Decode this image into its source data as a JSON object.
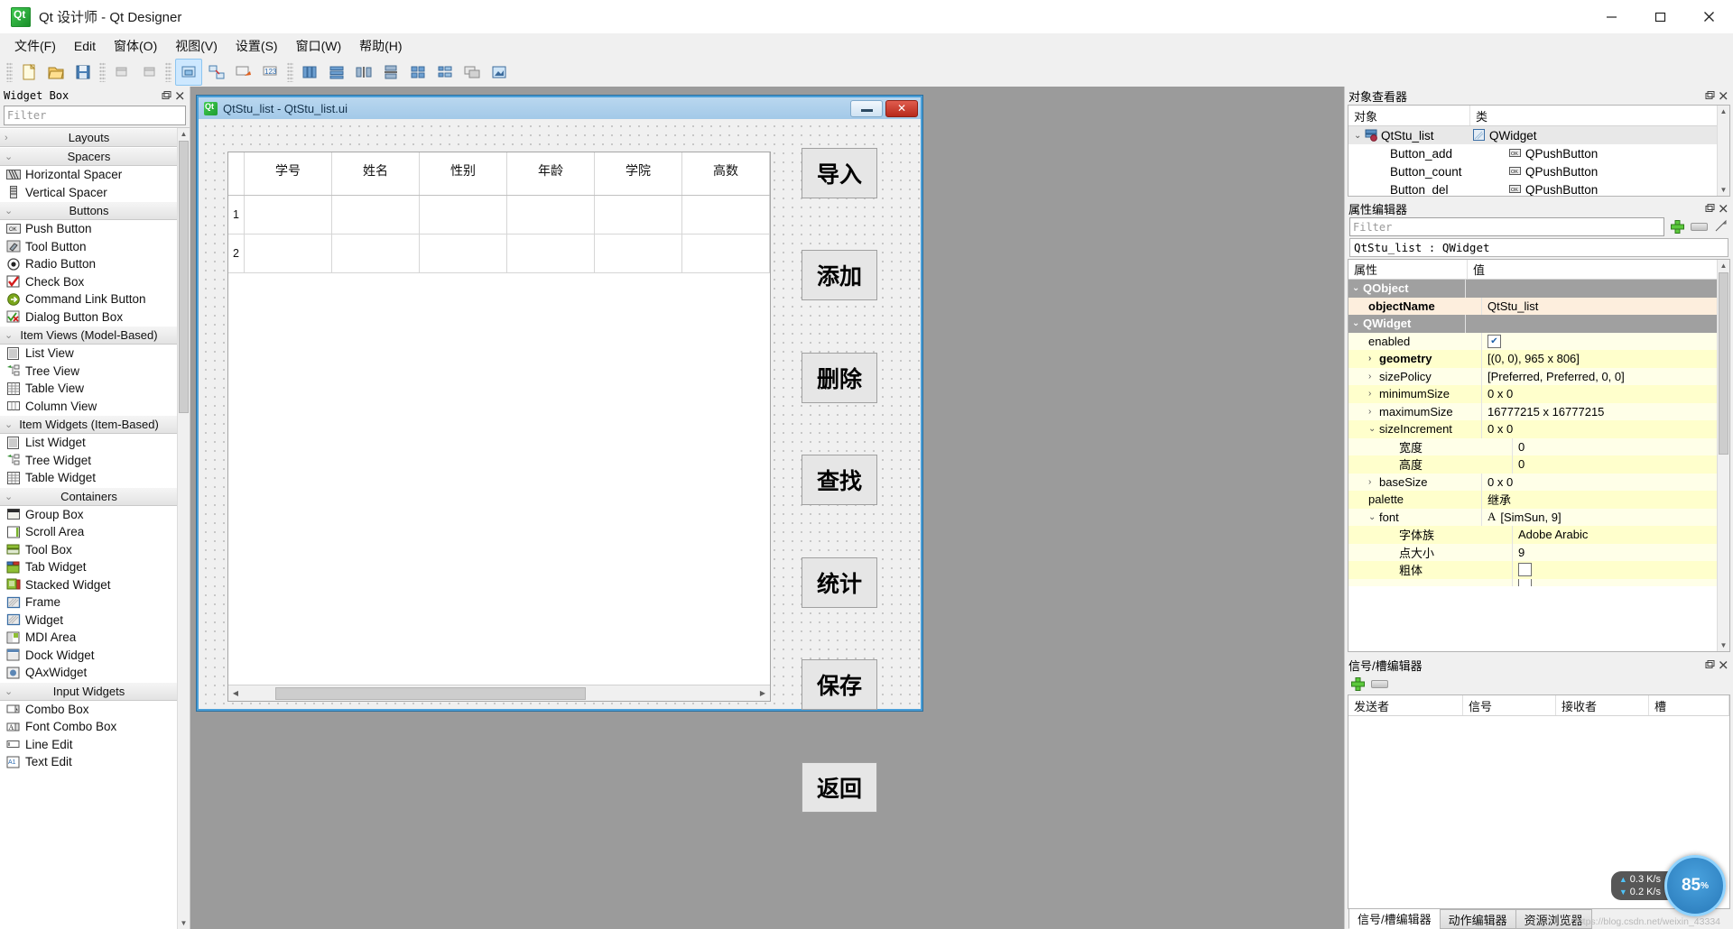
{
  "window": {
    "title": "Qt 设计师 - Qt Designer",
    "app_icon": "qt-logo-icon",
    "minimize": "−",
    "maximize": "□",
    "close": "✕"
  },
  "menubar": {
    "items": [
      {
        "label": "文件(F)",
        "name": "menu-file"
      },
      {
        "label": "Edit",
        "name": "menu-edit"
      },
      {
        "label": "窗体(O)",
        "name": "menu-form"
      },
      {
        "label": "视图(V)",
        "name": "menu-view"
      },
      {
        "label": "设置(S)",
        "name": "menu-settings"
      },
      {
        "label": "窗口(W)",
        "name": "menu-window"
      },
      {
        "label": "帮助(H)",
        "name": "menu-help"
      }
    ]
  },
  "toolbar": {
    "buttons": [
      {
        "name": "new-form-icon",
        "glyph": "new"
      },
      {
        "name": "open-form-icon",
        "glyph": "open"
      },
      {
        "name": "save-form-icon",
        "glyph": "save"
      },
      {
        "name": "undo-icon",
        "glyph": "undo"
      },
      {
        "name": "redo-icon",
        "glyph": "redo"
      },
      {
        "name": "edit-widgets-icon",
        "glyph": "editwidget",
        "active": true
      },
      {
        "name": "edit-signals-slots-icon",
        "glyph": "signals"
      },
      {
        "name": "edit-buddies-icon",
        "glyph": "buddies"
      },
      {
        "name": "edit-tab-order-icon",
        "glyph": "taborder"
      },
      {
        "name": "layout-horizontally-icon",
        "glyph": "lay-h"
      },
      {
        "name": "layout-vertically-icon",
        "glyph": "lay-v"
      },
      {
        "name": "layout-splitter-h-icon",
        "glyph": "split-h"
      },
      {
        "name": "layout-splitter-v-icon",
        "glyph": "split-v"
      },
      {
        "name": "layout-grid-icon",
        "glyph": "grid"
      },
      {
        "name": "layout-form-icon",
        "glyph": "formlay"
      },
      {
        "name": "break-layout-icon",
        "glyph": "breaklay"
      },
      {
        "name": "adjust-size-icon",
        "glyph": "adjust"
      }
    ]
  },
  "widget_box": {
    "title": "Widget Box",
    "filter_placeholder": "Filter",
    "groups": [
      {
        "label": "Layouts",
        "expanded": false,
        "chevron": "›",
        "items": []
      },
      {
        "label": "Spacers",
        "expanded": true,
        "chevron": "⌄",
        "items": [
          {
            "label": "Horizontal Spacer",
            "icon": "horizontal-spacer-icon"
          },
          {
            "label": "Vertical Spacer",
            "icon": "vertical-spacer-icon"
          }
        ]
      },
      {
        "label": "Buttons",
        "expanded": true,
        "chevron": "⌄",
        "items": [
          {
            "label": "Push Button",
            "icon": "push-button-icon"
          },
          {
            "label": "Tool Button",
            "icon": "tool-button-icon"
          },
          {
            "label": "Radio Button",
            "icon": "radio-button-icon"
          },
          {
            "label": "Check Box",
            "icon": "check-box-icon"
          },
          {
            "label": "Command Link Button",
            "icon": "command-link-button-icon"
          },
          {
            "label": "Dialog Button Box",
            "icon": "dialog-button-box-icon"
          }
        ]
      },
      {
        "label": "Item Views (Model-Based)",
        "expanded": true,
        "chevron": "⌄",
        "items": [
          {
            "label": "List View",
            "icon": "list-view-icon"
          },
          {
            "label": "Tree View",
            "icon": "tree-view-icon"
          },
          {
            "label": "Table View",
            "icon": "table-view-icon"
          },
          {
            "label": "Column View",
            "icon": "column-view-icon"
          }
        ]
      },
      {
        "label": "Item Widgets (Item-Based)",
        "expanded": true,
        "chevron": "⌄",
        "items": [
          {
            "label": "List Widget",
            "icon": "list-widget-icon"
          },
          {
            "label": "Tree Widget",
            "icon": "tree-widget-icon"
          },
          {
            "label": "Table Widget",
            "icon": "table-widget-icon"
          }
        ]
      },
      {
        "label": "Containers",
        "expanded": true,
        "chevron": "⌄",
        "items": [
          {
            "label": "Group Box",
            "icon": "group-box-icon"
          },
          {
            "label": "Scroll Area",
            "icon": "scroll-area-icon"
          },
          {
            "label": "Tool Box",
            "icon": "tool-box-icon"
          },
          {
            "label": "Tab Widget",
            "icon": "tab-widget-icon"
          },
          {
            "label": "Stacked Widget",
            "icon": "stacked-widget-icon"
          },
          {
            "label": "Frame",
            "icon": "frame-icon"
          },
          {
            "label": "Widget",
            "icon": "widget-icon"
          },
          {
            "label": "MDI Area",
            "icon": "mdi-area-icon"
          },
          {
            "label": "Dock Widget",
            "icon": "dock-widget-icon"
          },
          {
            "label": "QAxWidget",
            "icon": "qax-widget-icon"
          }
        ]
      },
      {
        "label": "Input Widgets",
        "expanded": true,
        "chevron": "⌄",
        "items": [
          {
            "label": "Combo Box",
            "icon": "combo-box-icon"
          },
          {
            "label": "Font Combo Box",
            "icon": "font-combo-box-icon"
          },
          {
            "label": "Line Edit",
            "icon": "line-edit-icon"
          },
          {
            "label": "Text Edit",
            "icon": "text-edit-icon"
          }
        ]
      }
    ]
  },
  "form": {
    "title": "QtStu_list - QtStu_list.ui",
    "icon": "qt-form-icon",
    "minimize": "",
    "close": "✕",
    "table": {
      "columns": [
        "学号",
        "姓名",
        "性别",
        "年龄",
        "学院",
        "高数"
      ],
      "rows": [
        {
          "header": "1",
          "cells": [
            "",
            "",
            "",
            "",
            "",
            ""
          ]
        },
        {
          "header": "2",
          "cells": [
            "",
            "",
            "",
            "",
            "",
            ""
          ]
        }
      ]
    },
    "buttons": [
      {
        "label": "导入",
        "name": "import-button"
      },
      {
        "label": "添加",
        "name": "add-button"
      },
      {
        "label": "删除",
        "name": "delete-button"
      },
      {
        "label": "查找",
        "name": "search-button"
      },
      {
        "label": "统计",
        "name": "count-button"
      },
      {
        "label": "保存",
        "name": "save-button"
      },
      {
        "label": "返回",
        "name": "back-button"
      }
    ]
  },
  "object_inspector": {
    "title": "对象查看器",
    "columns": [
      "对象",
      "类"
    ],
    "rows": [
      {
        "name": "QtStu_list",
        "class": "QWidget",
        "level": 0,
        "expanded": true,
        "chevron": "⌄",
        "icon": "widget-icon",
        "selected": true
      },
      {
        "name": "Button_add",
        "class": "QPushButton",
        "level": 1,
        "icon": "pushbutton-icon",
        "selected": false
      },
      {
        "name": "Button_count",
        "class": "QPushButton",
        "level": 1,
        "icon": "pushbutton-icon",
        "selected": false
      },
      {
        "name": "Button_del",
        "class": "QPushButton",
        "level": 1,
        "icon": "pushbutton-icon",
        "selected": false
      }
    ]
  },
  "property_editor": {
    "title": "属性编辑器",
    "filter_placeholder": "Filter",
    "object_line": "QtStu_list : QWidget",
    "columns": [
      "属性",
      "值"
    ],
    "add_icon": "plus-icon",
    "remove_icon": "minus-icon",
    "config_icon": "wrench-icon",
    "rows": [
      {
        "name": "QObject",
        "value": "",
        "kind": "group",
        "chevron": "⌄",
        "indent": 0
      },
      {
        "name": "objectName",
        "value": "QtStu_list",
        "kind": "peach",
        "indent": 1,
        "bold": true
      },
      {
        "name": "QWidget",
        "value": "",
        "kind": "group",
        "chevron": "⌄",
        "indent": 0
      },
      {
        "name": "enabled",
        "value": "",
        "kind": "lyellow",
        "indent": 1,
        "checkbox": true,
        "checked": true
      },
      {
        "name": "geometry",
        "value": "[(0, 0), 965 x 806]",
        "kind": "yellow",
        "indent": 1,
        "chevron": "›",
        "bold": true
      },
      {
        "name": "sizePolicy",
        "value": "[Preferred, Preferred, 0, 0]",
        "kind": "lyellow",
        "indent": 1,
        "chevron": "›"
      },
      {
        "name": "minimumSize",
        "value": "0 x 0",
        "kind": "yellow",
        "indent": 1,
        "chevron": "›"
      },
      {
        "name": "maximumSize",
        "value": "16777215 x 16777215",
        "kind": "lyellow",
        "indent": 1,
        "chevron": "›"
      },
      {
        "name": "sizeIncrement",
        "value": "0 x 0",
        "kind": "yellow",
        "indent": 1,
        "chevron": "⌄"
      },
      {
        "name": "宽度",
        "value": "0",
        "kind": "lyellow",
        "indent": 2
      },
      {
        "name": "高度",
        "value": "0",
        "kind": "yellow",
        "indent": 2
      },
      {
        "name": "baseSize",
        "value": "0 x 0",
        "kind": "lyellow",
        "indent": 1,
        "chevron": "›"
      },
      {
        "name": "palette",
        "value": "继承",
        "kind": "yellow",
        "indent": 1
      },
      {
        "name": "font",
        "value": "[SimSun, 9]",
        "kind": "lyellow",
        "indent": 1,
        "chevron": "⌄",
        "font_icon": "A"
      },
      {
        "name": "字体族",
        "value": "Adobe Arabic",
        "kind": "yellow",
        "indent": 2
      },
      {
        "name": "点大小",
        "value": "9",
        "kind": "lyellow",
        "indent": 2
      },
      {
        "name": "粗体",
        "value": "",
        "kind": "yellow",
        "indent": 2,
        "checkbox": true,
        "checked": false
      }
    ]
  },
  "signal_slot_editor": {
    "title": "信号/槽编辑器",
    "add_icon": "plus-icon",
    "remove_icon": "minus-icon",
    "columns": [
      "发送者",
      "信号",
      "接收者",
      "槽"
    ],
    "rows": []
  },
  "bottom_tabs": [
    {
      "label": "信号/槽编辑器",
      "active": true,
      "name": "tab-signal-slot-editor"
    },
    {
      "label": "动作编辑器",
      "active": false,
      "name": "tab-action-editor"
    },
    {
      "label": "资源浏览器",
      "active": false,
      "name": "tab-resource-browser"
    }
  ],
  "net_widget": {
    "upload": "0.3",
    "upload_unit": "K/s",
    "download": "0.2",
    "download_unit": "K/s",
    "gauge_value": "85",
    "gauge_unit": "%"
  },
  "watermark": "https://blog.csdn.net/weixin_43334",
  "colors": {
    "accent": "#4a9fd8",
    "group_row": "#a0a0a0",
    "peach": "#fdeedd",
    "yellow": "#ffffcc",
    "canvas": "#9b9b9b"
  }
}
